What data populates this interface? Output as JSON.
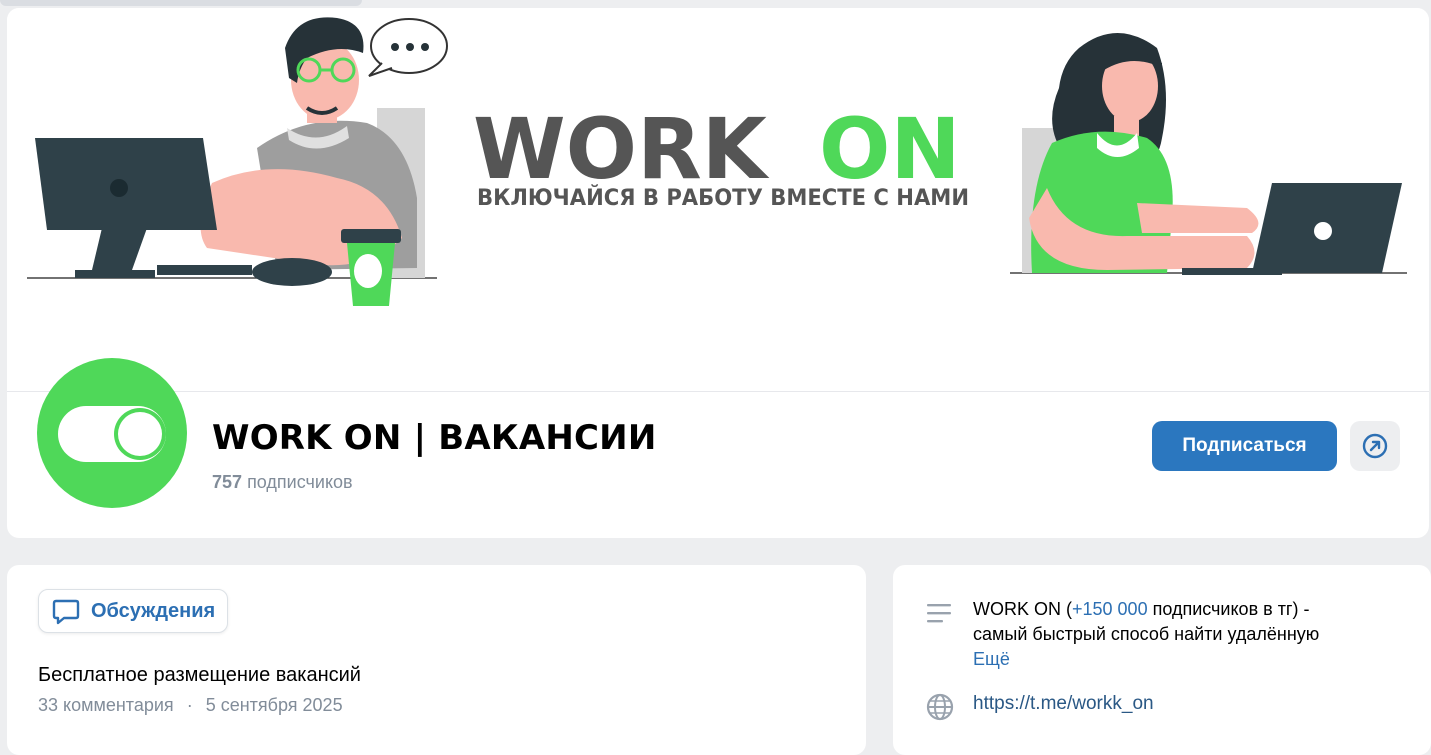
{
  "cover": {
    "brand_work": "WORK",
    "brand_on": "ON",
    "slogan": "ВКЛЮЧАЙСЯ В РАБОТУ ВМЕСТЕ С НАМИ",
    "colors": {
      "green": "#4fd859",
      "dark": "#555555",
      "monitor": "#2f4149"
    }
  },
  "group": {
    "name": "WORK ON | ВАКАНСИИ",
    "subscribers_count": "757",
    "subscribers_label": "подписчиков",
    "subscribe_label": "Подписаться",
    "accent": "#2b77bf"
  },
  "discussions": {
    "chip_label": "Обсуждения",
    "topic_title": "Бесплатное размещение вакансий",
    "topic_comments": "33 комментария",
    "topic_separator": "·",
    "topic_date": "5 сентября 2025"
  },
  "about": {
    "desc_before": "WORK ON (",
    "desc_highlight": "+150 000",
    "desc_after": " подписчиков в тг) -",
    "desc_line2": "самый быстрый способ найти удалённую",
    "more_label": "Ещё",
    "link": "https://t.me/workk_on"
  }
}
